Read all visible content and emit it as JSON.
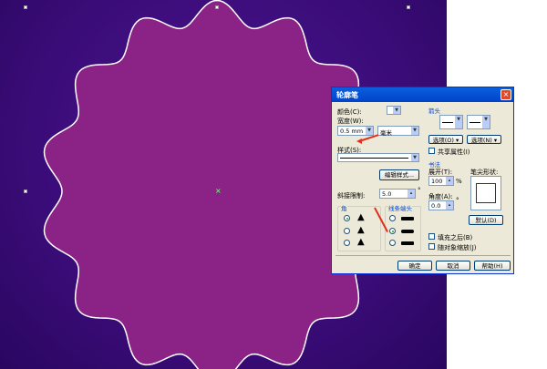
{
  "canvas": {
    "shape_fill": "#8b2387",
    "outline": "#ffffff",
    "background": "#3a0c78"
  },
  "dialog": {
    "title": "轮廓笔",
    "close": "×",
    "color_label": "颜色(C):",
    "width_label": "宽度(W):",
    "width_value": "0.5 mm",
    "unit_value": "毫米",
    "style_label": "样式(S):",
    "edit_style": "编辑样式...",
    "miter_label": "斜接限制:",
    "miter_value": "5.0",
    "degree": "°",
    "corner_group": "角",
    "cap_group": "线条端头",
    "arrow_group": "箭头",
    "option_left": "选项(O)",
    "option_right": "选项(N)",
    "share_attr": "共享属性(I)",
    "calligraphy_group": "书法",
    "stretch_label": "展开(T):",
    "stretch_value": "100",
    "percent": "%",
    "nib_label": "笔尖形状:",
    "angle_label": "角度(A):",
    "angle_value": "0.0",
    "default_btn": "默认(D)",
    "behind_fill": "填充之后(B)",
    "scale_with": "随对象缩放(J)",
    "ok": "确定",
    "cancel": "取消",
    "help": "帮助(H)"
  }
}
